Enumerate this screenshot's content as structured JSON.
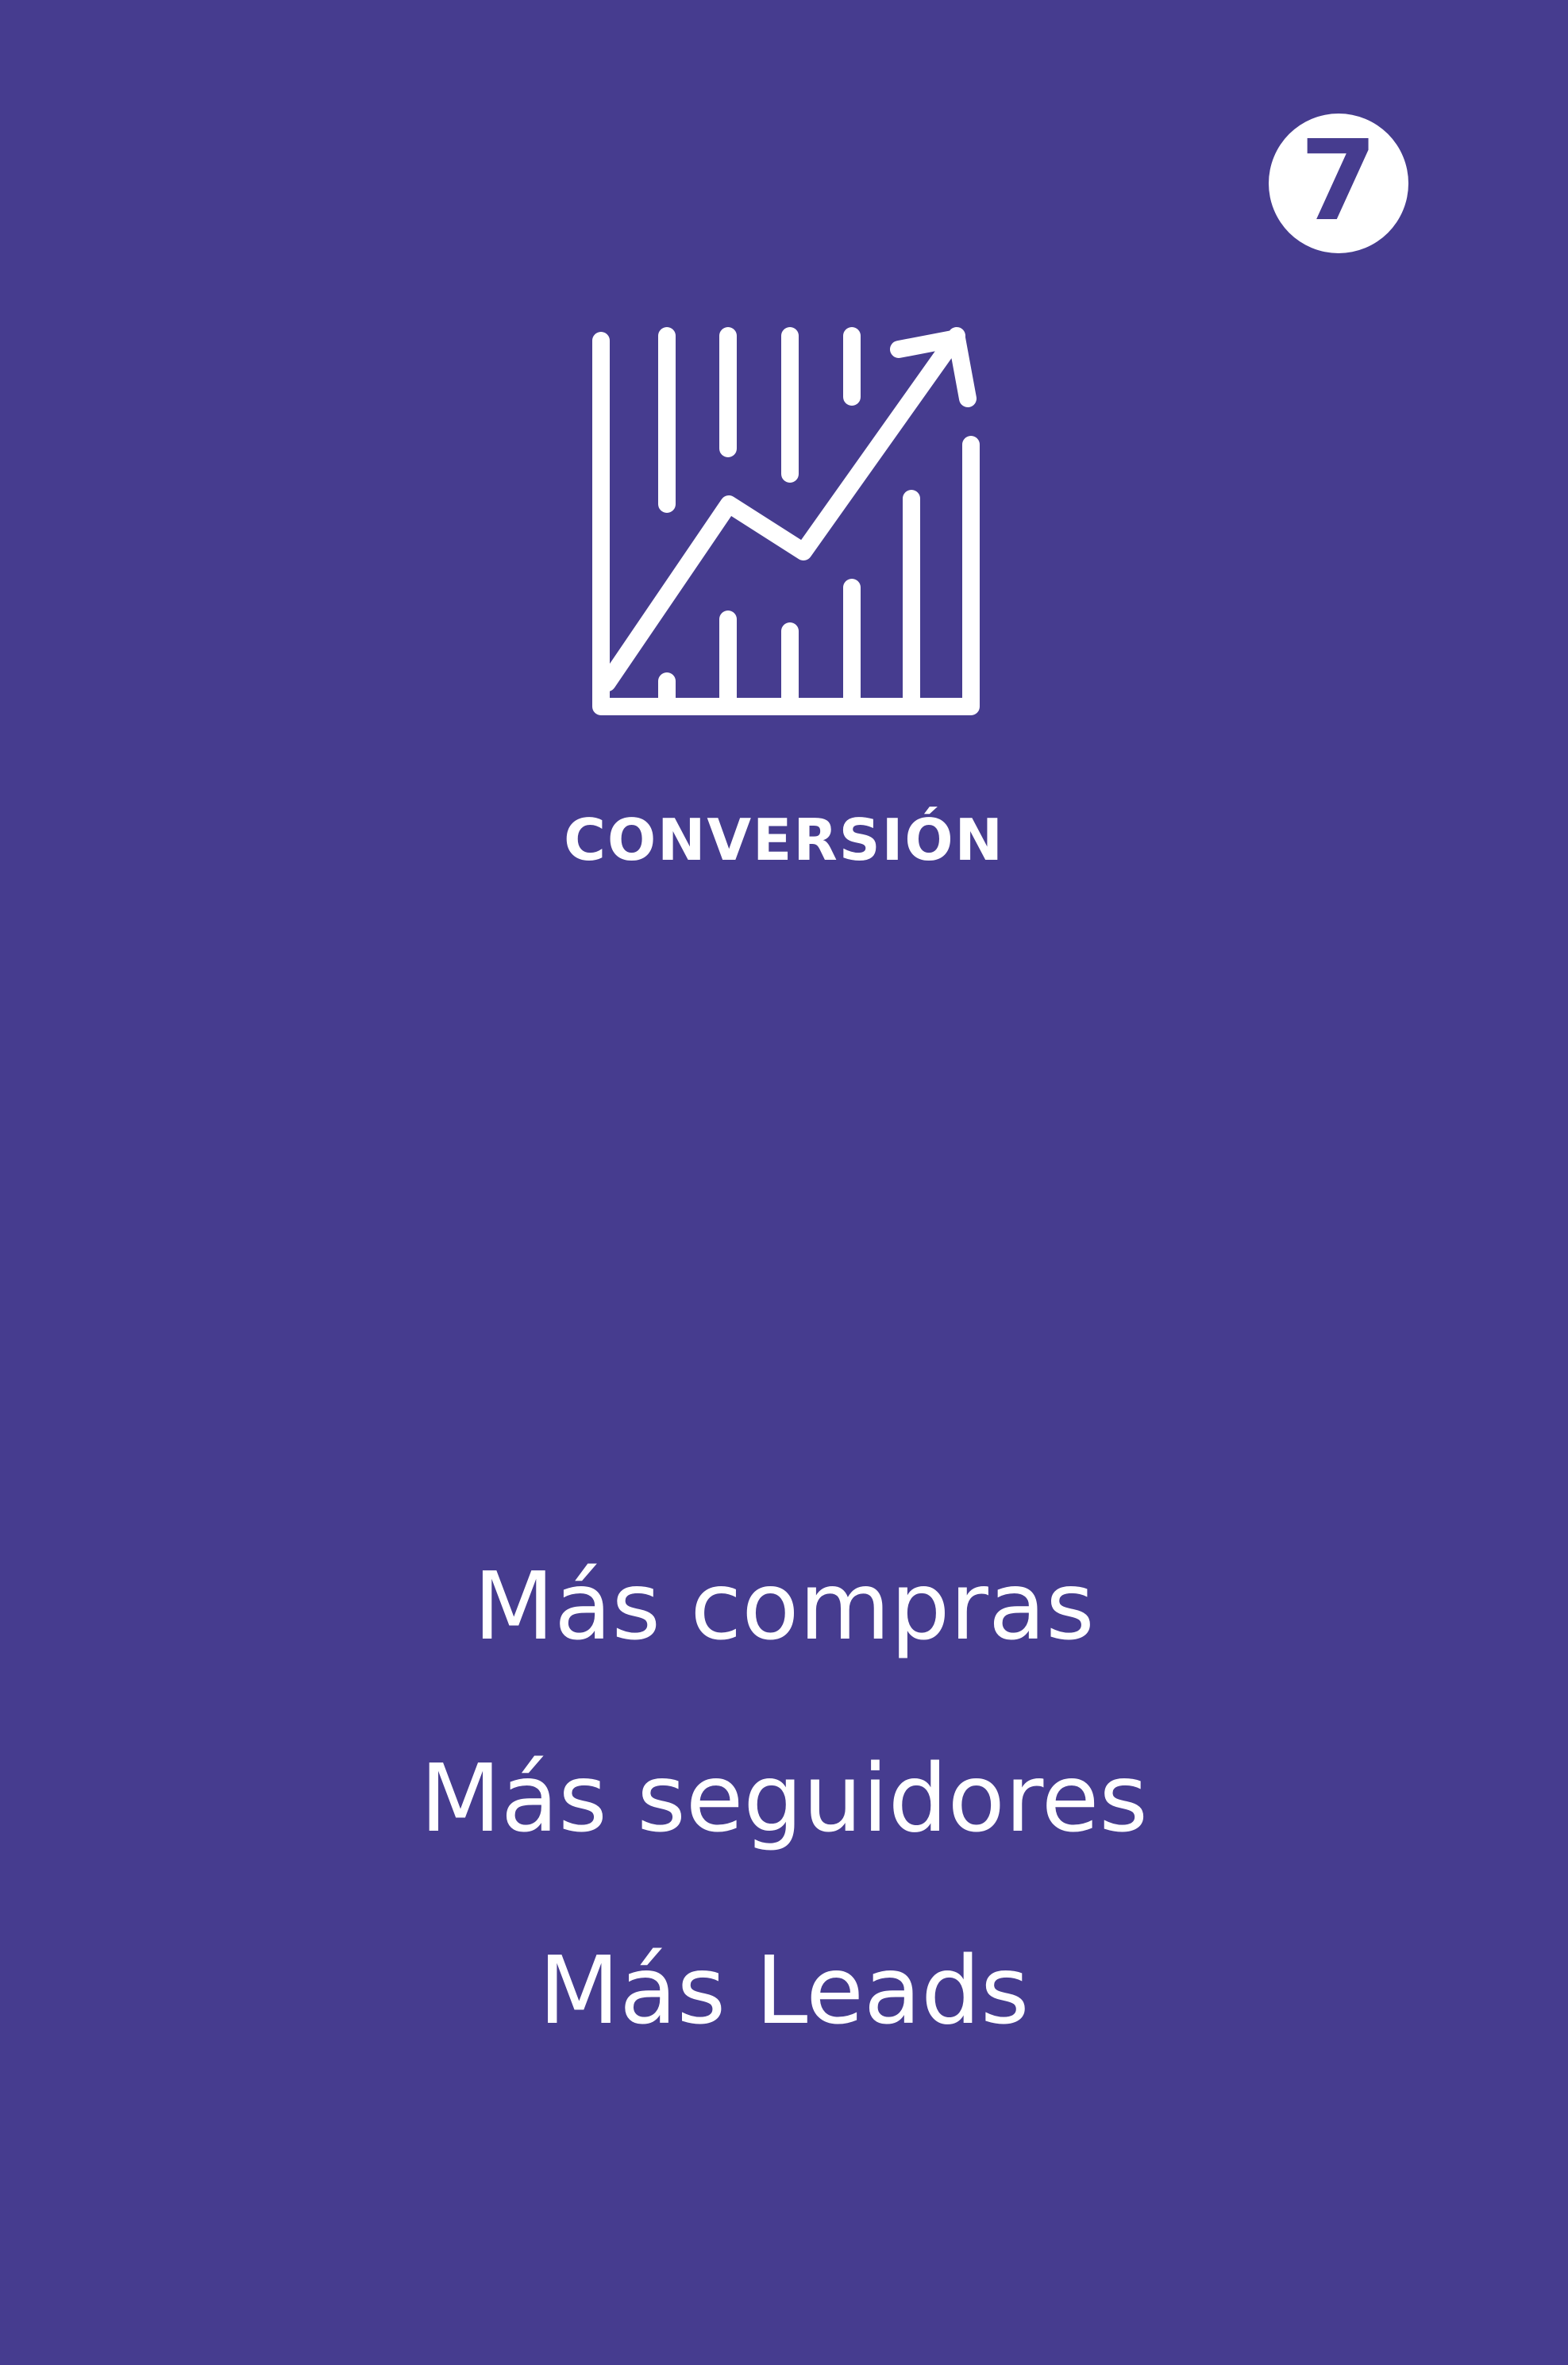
{
  "badge": {
    "number": "7"
  },
  "icon": {
    "name": "growth-chart-icon"
  },
  "title": "CONVERSIÓN",
  "benefits": [
    "Más compras",
    "Más seguidores",
    "Más Leads"
  ],
  "colors": {
    "background": "#463c8f",
    "foreground": "#ffffff"
  }
}
